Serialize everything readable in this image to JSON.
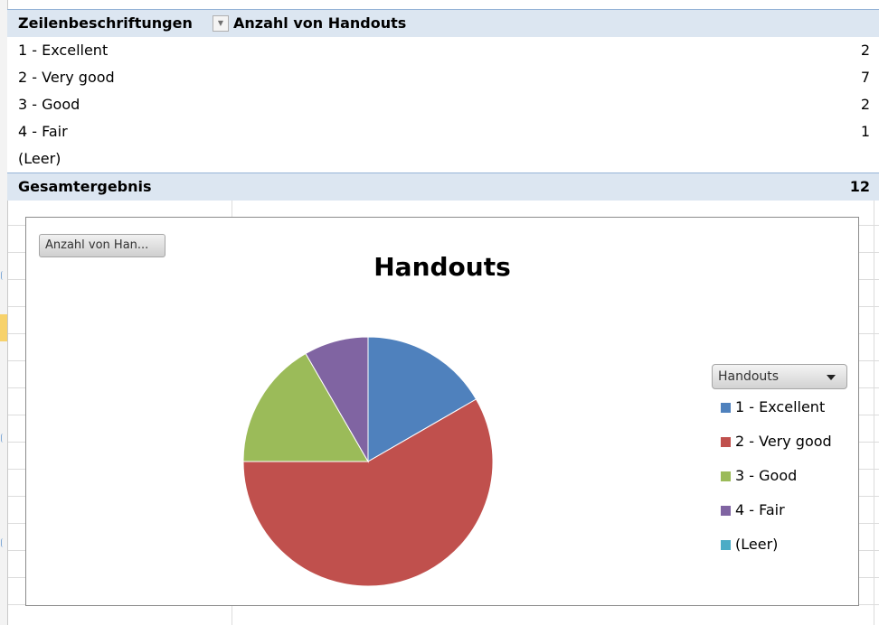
{
  "pivot": {
    "header_label": "Zeilenbeschriftungen",
    "header_value": "Anzahl von Handouts",
    "rows": [
      {
        "label": "1 - Excellent",
        "value": "2"
      },
      {
        "label": "2 - Very good",
        "value": "7"
      },
      {
        "label": "3 - Good",
        "value": "2"
      },
      {
        "label": "4 - Fair",
        "value": "1"
      },
      {
        "label": "(Leer)",
        "value": ""
      }
    ],
    "total_label": "Gesamtergebnis",
    "total_value": "12"
  },
  "chart": {
    "field_button": "Anzahl von Han...",
    "legend_dropdown": "Handouts"
  },
  "chart_data": {
    "type": "pie",
    "title": "Handouts",
    "categories": [
      "1 - Excellent",
      "2 - Very good",
      "3 - Good",
      "4 - Fair",
      "(Leer)"
    ],
    "values": [
      2,
      7,
      2,
      1,
      0
    ],
    "colors": [
      "#4f81bd",
      "#c0504d",
      "#9bbb59",
      "#8064a2",
      "#4bacc6"
    ],
    "legend": "right"
  }
}
